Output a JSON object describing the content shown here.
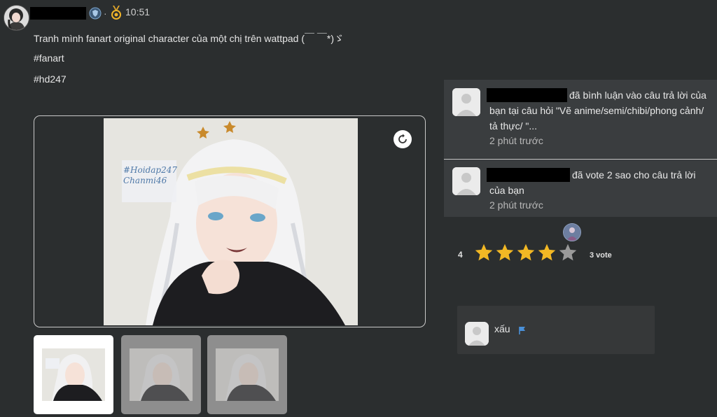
{
  "post": {
    "time": "10:51",
    "dot": "·",
    "icons": {
      "level_badge": "shield-badge-icon",
      "medal": "medal-icon"
    },
    "text": "Tranh mình fanart original character của một chị trên wattpad (￣ ￣*)ゞ",
    "tag1": "#fanart",
    "tag2": "#hd247",
    "image_caption": "#Hoidap247\nChanmi46",
    "rotate_icon": "rotate-icon",
    "thumbnails_count": 3
  },
  "notifications": [
    {
      "text": "đã bình luận vào câu trả lời của bạn tại câu hỏi \"Vẽ anime/semi/chibi/phong cảnh/ tả thực/ \"...",
      "ago": "2 phút trước"
    },
    {
      "text": "đã vote 2 sao cho câu trả lời của bạn",
      "ago": "2 phút trước"
    }
  ],
  "rating": {
    "value": "4",
    "stars_filled": 4,
    "stars_total": 5,
    "votes_label": "3 vote",
    "star_color": "#f2b824",
    "star_empty_color": "#9a9a9a"
  },
  "comment": {
    "text": "xấu",
    "flag_icon": "flag-icon",
    "flag_color": "#4a90d9"
  }
}
